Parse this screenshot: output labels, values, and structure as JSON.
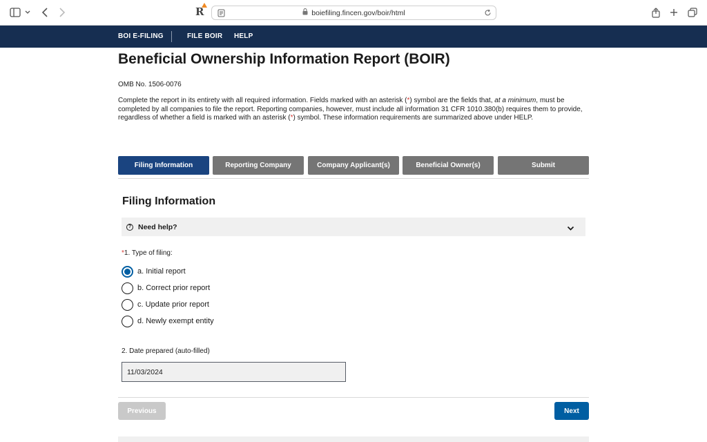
{
  "browser": {
    "url": "boiefiling.fincen.gov/boir/html"
  },
  "nav": {
    "items": [
      "BOI E-FILING",
      "FILE BOIR",
      "HELP"
    ]
  },
  "page": {
    "title": "Beneficial Ownership Information Report (BOIR)",
    "omb": "OMB No. 1506-0076",
    "intro": {
      "part1": "Complete the report in its entirety with all required information. Fields marked with an asterisk (",
      "asterisk": "*",
      "part2": ") symbol are the fields that, ",
      "emphasis": "at a minimum",
      "part3": ", must be completed by all companies to file the report. Reporting companies, however, must include all information 31 CFR 1010.380(b) requires them to provide, regardless of whether a field is marked with an asterisk (",
      "part4": ") symbol. These information requirements are summarized above under HELP."
    }
  },
  "tabs": [
    {
      "label": "Filing Information",
      "active": true
    },
    {
      "label": "Reporting Company",
      "active": false
    },
    {
      "label": "Company Applicant(s)",
      "active": false
    },
    {
      "label": "Beneficial Owner(s)",
      "active": false
    },
    {
      "label": "Submit",
      "active": false
    }
  ],
  "section": {
    "title": "Filing Information",
    "help_label": "Need help?"
  },
  "type_of_filing": {
    "asterisk": "*",
    "label": "1. Type of filing:",
    "options": [
      {
        "label": "a. Initial report",
        "selected": true
      },
      {
        "label": "b. Correct prior report",
        "selected": false
      },
      {
        "label": "c. Update prior report",
        "selected": false
      },
      {
        "label": "d. Newly exempt entity",
        "selected": false
      }
    ]
  },
  "date_prepared": {
    "label": "2. Date prepared (auto-filled)",
    "value": "11/03/2024"
  },
  "buttons": {
    "previous": "Previous",
    "next": "Next"
  },
  "colors": {
    "nav_bg": "#162e51",
    "active_tab": "#1a4480",
    "inactive_tab": "#757575",
    "primary_button": "#005ea2",
    "disabled_button": "#c9c9c9",
    "required_asterisk": "#d83933"
  }
}
